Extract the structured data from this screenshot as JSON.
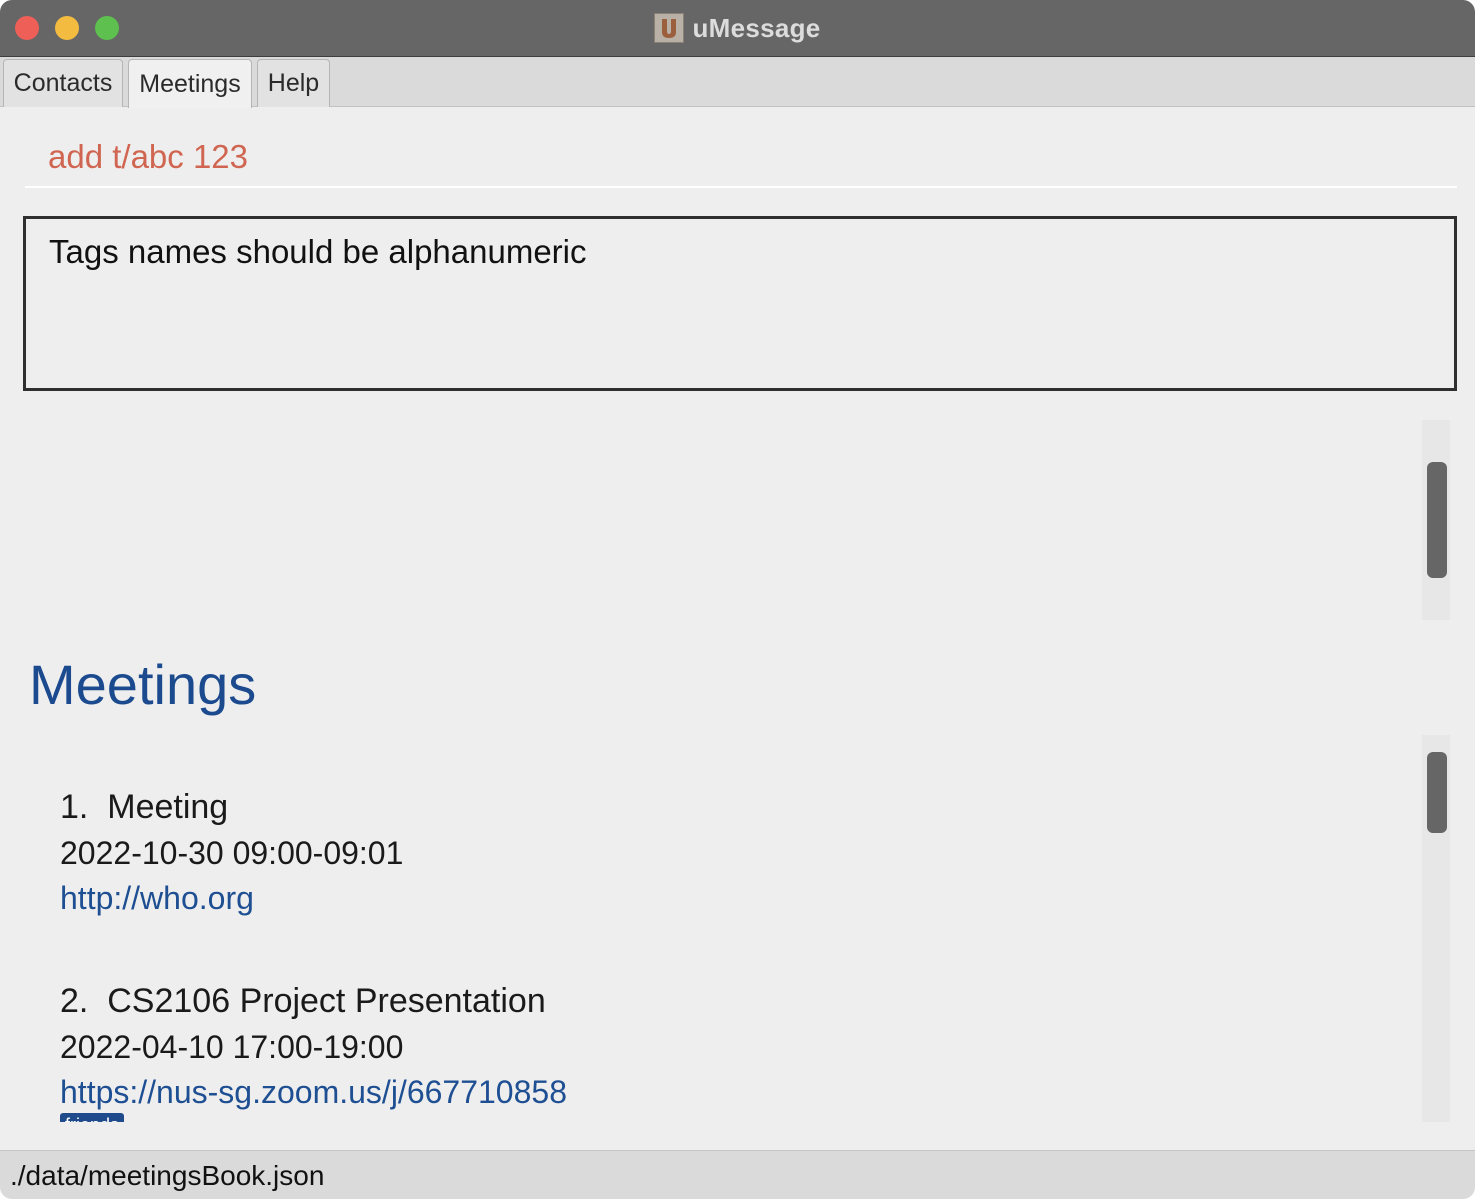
{
  "window": {
    "title": "uMessage",
    "app_icon_letter": "u"
  },
  "tabs": [
    {
      "label": "Contacts",
      "active": false
    },
    {
      "label": "Meetings",
      "active": true
    },
    {
      "label": "Help",
      "active": false
    }
  ],
  "command": {
    "value": "add t/abc 123",
    "text_color": "#d06651"
  },
  "result": {
    "message": "Tags names should be alphanumeric"
  },
  "meetings_section": {
    "heading": "Meetings",
    "items": [
      {
        "index_title": "1.  Meeting",
        "datetime": "2022-10-30 09:00-09:01",
        "link": "http://who.org",
        "tags": []
      },
      {
        "index_title": "2.  CS2106 Project Presentation",
        "datetime": "2022-04-10 17:00-19:00",
        "link": "https://nus-sg.zoom.us/j/667710858",
        "tags": [
          "friends"
        ]
      }
    ]
  },
  "status_bar": {
    "file_path": "./data/meetingsBook.json"
  },
  "colors": {
    "accent_blue": "#1b4a8e",
    "titlebar": "#666666",
    "traffic_close": "#ee5f58",
    "traffic_min": "#f3bc41",
    "traffic_max": "#5ec04e"
  }
}
